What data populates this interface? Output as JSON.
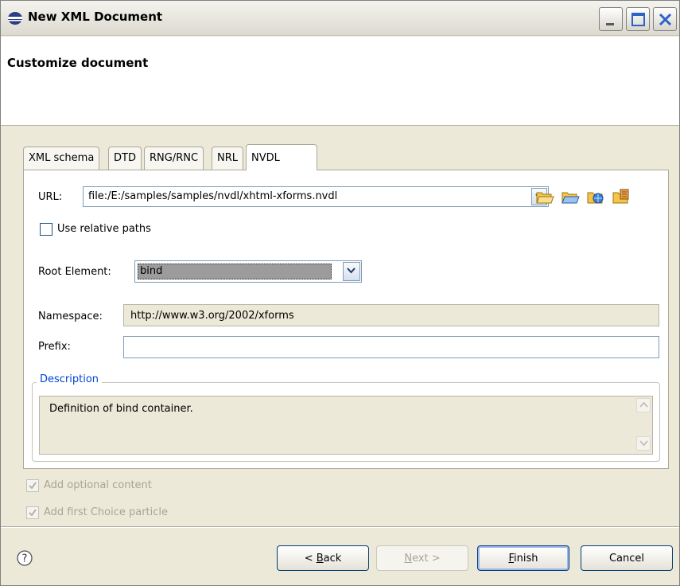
{
  "window": {
    "title": "New XML Document",
    "controls": {
      "minimize": "minimize",
      "maximize": "maximize",
      "close": "close"
    }
  },
  "banner": {
    "title": "Customize document"
  },
  "tabs": [
    {
      "label": "XML schema",
      "active": false
    },
    {
      "label": "DTD",
      "active": false
    },
    {
      "label": "RNG/RNC",
      "active": false
    },
    {
      "label": "NRL",
      "active": false
    },
    {
      "label": "NVDL",
      "active": true
    }
  ],
  "form": {
    "url_label": "URL:",
    "url_value": "file:/E:/samples/samples/nvdl/xhtml-xforms.nvdl",
    "relative_paths_label": "Use relative paths",
    "relative_paths_checked": false,
    "root_label": "Root Element:",
    "root_value": "bind",
    "namespace_label": "Namespace:",
    "namespace_value": "http://www.w3.org/2002/xforms",
    "prefix_label": "Prefix:",
    "prefix_value": ""
  },
  "description": {
    "legend": "Description",
    "text": "Definition of bind container."
  },
  "options": {
    "optional_content_label": "Add optional content",
    "optional_content_checked": true,
    "first_choice_label": "Add first Choice particle",
    "first_choice_checked": true
  },
  "buttons": {
    "back_prefix": "< ",
    "back_mnemonic": "B",
    "back_rest": "ack",
    "next_mnemonic": "N",
    "next_rest": "ext >",
    "finish_mnemonic": "F",
    "finish_rest": "inish",
    "cancel": "Cancel"
  },
  "colors": {
    "accent": "#0046d5",
    "close_button": "#2b63c9",
    "folder_yellow": "#f6c446"
  }
}
